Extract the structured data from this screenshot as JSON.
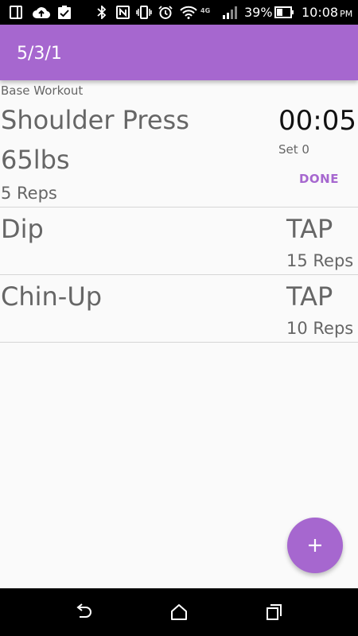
{
  "status_bar": {
    "battery_percent": "39%",
    "time": "10:08",
    "ampm": "PM",
    "network": "4G"
  },
  "app_bar": {
    "title": "5/3/1"
  },
  "workout": {
    "section_label": "Base Workout",
    "exercises": [
      {
        "name": "Shoulder Press",
        "weight": "65lbs",
        "reps": "5 Reps",
        "timer": "00:05",
        "set": "Set 0",
        "action": "DONE"
      },
      {
        "name": "Dip",
        "action": "TAP",
        "reps": "15 Reps"
      },
      {
        "name": "Chin-Up",
        "action": "TAP",
        "reps": "10 Reps"
      }
    ]
  },
  "colors": {
    "accent": "#a667cf",
    "background": "#fafafa",
    "text": "#666666"
  },
  "icons": {
    "fab": "plus-icon",
    "nav": [
      "back-icon",
      "home-icon",
      "recents-icon"
    ]
  }
}
